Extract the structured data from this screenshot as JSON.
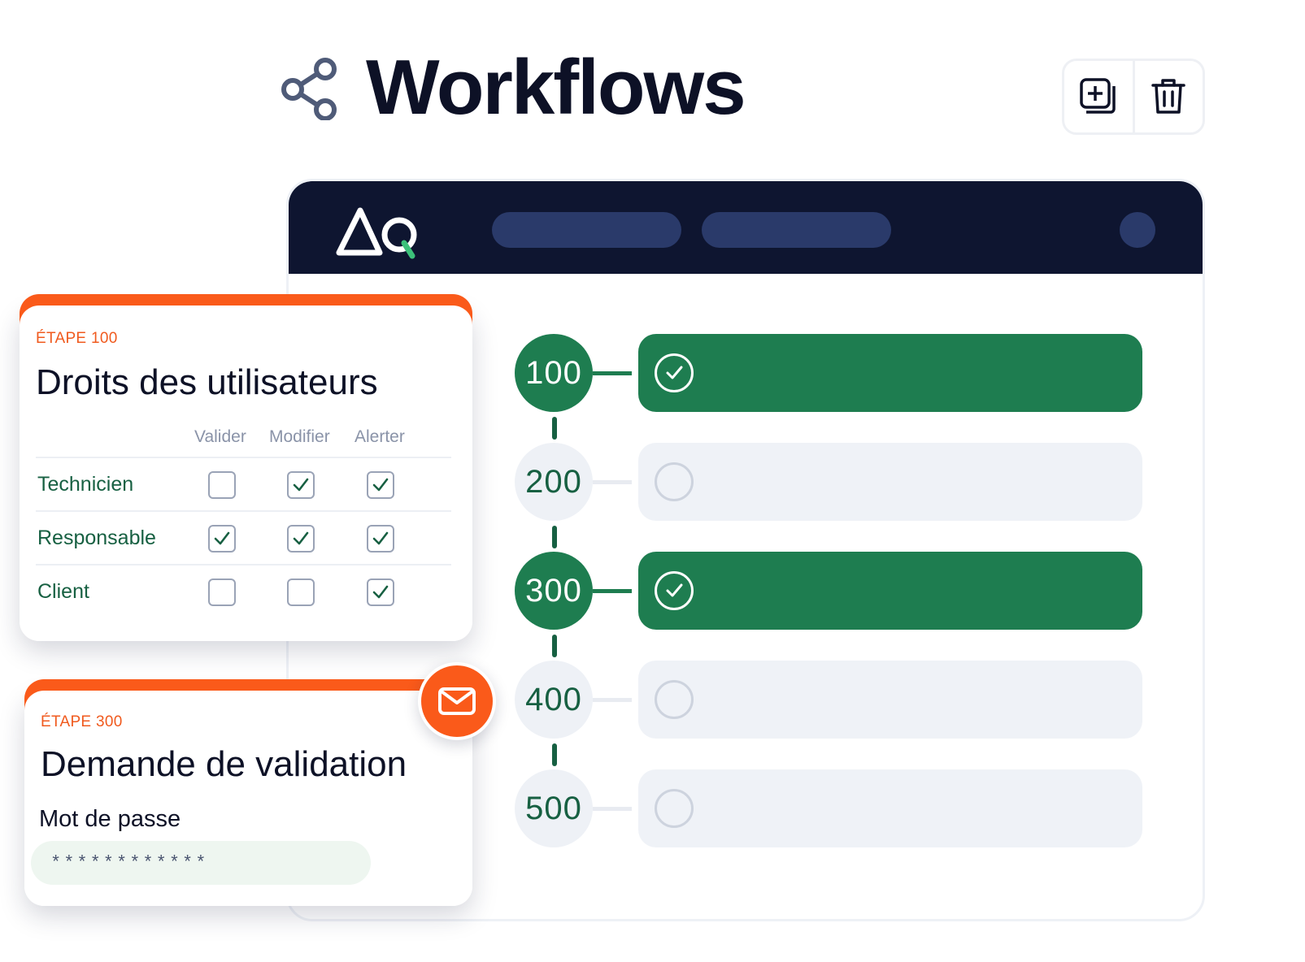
{
  "header": {
    "title": "Workflows",
    "icon": "share-icon",
    "actions": [
      {
        "icon": "add-copy-icon",
        "label": "add"
      },
      {
        "icon": "trash-icon",
        "label": "delete"
      }
    ]
  },
  "app": {
    "navbar": {
      "logo_icon": "aq-logo-icon",
      "pill_count": 2
    },
    "steps": [
      {
        "number": "100",
        "status": "done"
      },
      {
        "number": "200",
        "status": "todo"
      },
      {
        "number": "300",
        "status": "done"
      },
      {
        "number": "400",
        "status": "todo"
      },
      {
        "number": "500",
        "status": "todo"
      }
    ]
  },
  "rights_card": {
    "eyebrow": "ÉTAPE 100",
    "title": "Droits des utilisateurs",
    "columns": [
      "Valider",
      "Modifier",
      "Alerter"
    ],
    "rows": [
      {
        "label": "Technicien",
        "checks": [
          false,
          true,
          true
        ]
      },
      {
        "label": "Responsable",
        "checks": [
          true,
          true,
          true
        ]
      },
      {
        "label": "Client",
        "checks": [
          false,
          false,
          true
        ]
      }
    ]
  },
  "validation_card": {
    "eyebrow": "ÉTAPE 300",
    "title": "Demande de validation",
    "field_label": "Mot de passe",
    "password_value": "************",
    "badge_icon": "mail-icon"
  },
  "colors": {
    "accent_orange": "#fa5a1a",
    "green": "#1e7d50",
    "navy": "#0e1530"
  }
}
